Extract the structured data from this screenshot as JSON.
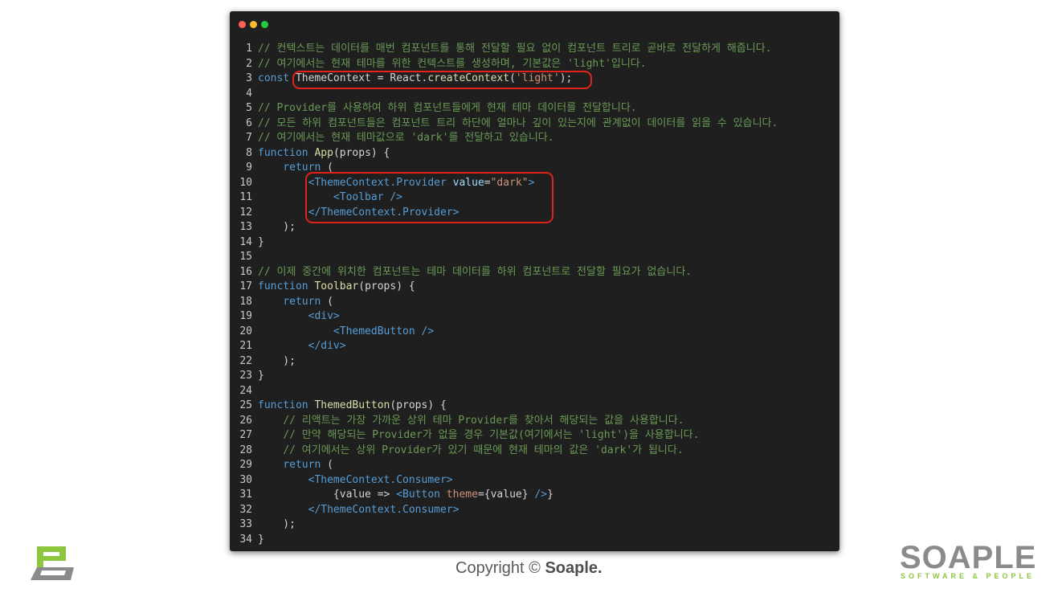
{
  "window": {
    "controls": [
      "close",
      "minimize",
      "zoom"
    ],
    "colors": {
      "close": "#fe5f57",
      "minimize": "#febc2e",
      "zoom": "#28c840"
    }
  },
  "code_lines": [
    {
      "n": "1",
      "tokens": [
        {
          "t": "// 컨텍스트는 데이터를 매번 컴포넌트를 통해 전달할 필요 없이 컴포넌트 트리로 곧바로 전달하게 해줍니다.",
          "c": "c"
        }
      ]
    },
    {
      "n": "2",
      "tokens": [
        {
          "t": "// 여기에서는 현재 테마를 위한 컨텍스트를 생성하며, 기본값은 'light'입니다.",
          "c": "c"
        }
      ]
    },
    {
      "n": "3",
      "tokens": [
        {
          "t": "const",
          "c": "k"
        },
        {
          "t": " ThemeContext = React.",
          "c": "p"
        },
        {
          "t": "createContext",
          "c": "f"
        },
        {
          "t": "(",
          "c": "p"
        },
        {
          "t": "'light'",
          "c": "s"
        },
        {
          "t": ");",
          "c": "p"
        }
      ]
    },
    {
      "n": "4",
      "tokens": []
    },
    {
      "n": "5",
      "tokens": [
        {
          "t": "// Provider를 사용하여 하위 컴포넌트들에게 현재 테마 데이터를 전달합니다.",
          "c": "c"
        }
      ]
    },
    {
      "n": "6",
      "tokens": [
        {
          "t": "// 모든 하위 컴포넌트들은 컴포넌트 트리 하단에 얼마나 깊이 있는지에 관계없이 데이터를 읽을 수 있습니다.",
          "c": "c"
        }
      ]
    },
    {
      "n": "7",
      "tokens": [
        {
          "t": "// 여기에서는 현재 테마값으로 'dark'를 전달하고 있습니다.",
          "c": "c"
        }
      ]
    },
    {
      "n": "8",
      "tokens": [
        {
          "t": "function",
          "c": "k"
        },
        {
          "t": " ",
          "c": "p"
        },
        {
          "t": "App",
          "c": "f"
        },
        {
          "t": "(props) {",
          "c": "p"
        }
      ]
    },
    {
      "n": "9",
      "tokens": [
        {
          "t": "    ",
          "c": "p"
        },
        {
          "t": "return",
          "c": "k"
        },
        {
          "t": " (",
          "c": "p"
        }
      ]
    },
    {
      "n": "10",
      "tokens": [
        {
          "t": "        ",
          "c": "p"
        },
        {
          "t": "<ThemeContext.Provider",
          "c": "tg"
        },
        {
          "t": " value",
          "c": "at"
        },
        {
          "t": "=",
          "c": "p"
        },
        {
          "t": "\"dark\"",
          "c": "s"
        },
        {
          "t": ">",
          "c": "tg"
        }
      ]
    },
    {
      "n": "11",
      "tokens": [
        {
          "t": "            ",
          "c": "p"
        },
        {
          "t": "<Toolbar />",
          "c": "tg"
        }
      ]
    },
    {
      "n": "12",
      "tokens": [
        {
          "t": "        ",
          "c": "p"
        },
        {
          "t": "</ThemeContext.Provider>",
          "c": "tg"
        }
      ]
    },
    {
      "n": "13",
      "tokens": [
        {
          "t": "    );",
          "c": "p"
        }
      ]
    },
    {
      "n": "14",
      "tokens": [
        {
          "t": "}",
          "c": "p"
        }
      ]
    },
    {
      "n": "15",
      "tokens": []
    },
    {
      "n": "16",
      "tokens": [
        {
          "t": "// 이제 중간에 위치한 컴포넌트는 테마 데이터를 하위 컴포넌트로 전달할 필요가 없습니다.",
          "c": "c"
        }
      ]
    },
    {
      "n": "17",
      "tokens": [
        {
          "t": "function",
          "c": "k"
        },
        {
          "t": " ",
          "c": "p"
        },
        {
          "t": "Toolbar",
          "c": "f"
        },
        {
          "t": "(props) {",
          "c": "p"
        }
      ]
    },
    {
      "n": "18",
      "tokens": [
        {
          "t": "    ",
          "c": "p"
        },
        {
          "t": "return",
          "c": "k"
        },
        {
          "t": " (",
          "c": "p"
        }
      ]
    },
    {
      "n": "19",
      "tokens": [
        {
          "t": "        ",
          "c": "p"
        },
        {
          "t": "<div>",
          "c": "tg"
        }
      ]
    },
    {
      "n": "20",
      "tokens": [
        {
          "t": "            ",
          "c": "p"
        },
        {
          "t": "<ThemedButton />",
          "c": "tg"
        }
      ]
    },
    {
      "n": "21",
      "tokens": [
        {
          "t": "        ",
          "c": "p"
        },
        {
          "t": "</div>",
          "c": "tg"
        }
      ]
    },
    {
      "n": "22",
      "tokens": [
        {
          "t": "    );",
          "c": "p"
        }
      ]
    },
    {
      "n": "23",
      "tokens": [
        {
          "t": "}",
          "c": "p"
        }
      ]
    },
    {
      "n": "24",
      "tokens": []
    },
    {
      "n": "25",
      "tokens": [
        {
          "t": "function",
          "c": "k"
        },
        {
          "t": " ",
          "c": "p"
        },
        {
          "t": "ThemedButton",
          "c": "f"
        },
        {
          "t": "(props) {",
          "c": "p"
        }
      ]
    },
    {
      "n": "26",
      "tokens": [
        {
          "t": "    ",
          "c": "p"
        },
        {
          "t": "// 리액트는 가장 가까운 상위 테마 Provider를 찾아서 해당되는 값을 사용합니다.",
          "c": "c"
        }
      ]
    },
    {
      "n": "27",
      "tokens": [
        {
          "t": "    ",
          "c": "p"
        },
        {
          "t": "// 만약 해당되는 Provider가 없을 경우 기본값(여기에서는 'light')을 사용합니다.",
          "c": "c"
        }
      ]
    },
    {
      "n": "28",
      "tokens": [
        {
          "t": "    ",
          "c": "p"
        },
        {
          "t": "// 여기에서는 상위 Provider가 있기 때문에 현재 테마의 값은 'dark'가 됩니다.",
          "c": "c"
        }
      ]
    },
    {
      "n": "29",
      "tokens": [
        {
          "t": "    ",
          "c": "p"
        },
        {
          "t": "return",
          "c": "k"
        },
        {
          "t": " (",
          "c": "p"
        }
      ]
    },
    {
      "n": "30",
      "tokens": [
        {
          "t": "        ",
          "c": "p"
        },
        {
          "t": "<ThemeContext.Consumer>",
          "c": "tg"
        }
      ]
    },
    {
      "n": "31",
      "tokens": [
        {
          "t": "            {value => ",
          "c": "p"
        },
        {
          "t": "<Button",
          "c": "tg"
        },
        {
          "t": " theme",
          "c": "s"
        },
        {
          "t": "={value} ",
          "c": "p"
        },
        {
          "t": "/>",
          "c": "tg"
        },
        {
          "t": "}",
          "c": "p"
        }
      ]
    },
    {
      "n": "32",
      "tokens": [
        {
          "t": "        ",
          "c": "p"
        },
        {
          "t": "</ThemeContext.Consumer>",
          "c": "tg"
        }
      ]
    },
    {
      "n": "33",
      "tokens": [
        {
          "t": "    );",
          "c": "p"
        }
      ]
    },
    {
      "n": "34",
      "tokens": [
        {
          "t": "}",
          "c": "p"
        }
      ]
    }
  ],
  "footer": {
    "copyright_prefix": "Copyright ©",
    "copyright_brand": "Soaple."
  },
  "brand": {
    "name": "SOAPLE",
    "tagline": "SOFTWARE & PEOPLE",
    "logo_icon": "soaple-logo-icon"
  },
  "colors": {
    "editor_bg": "#1f1f1f",
    "highlight": "#e0231b",
    "brand_green": "#8dc63f",
    "brand_gray": "#8b8b8b"
  }
}
